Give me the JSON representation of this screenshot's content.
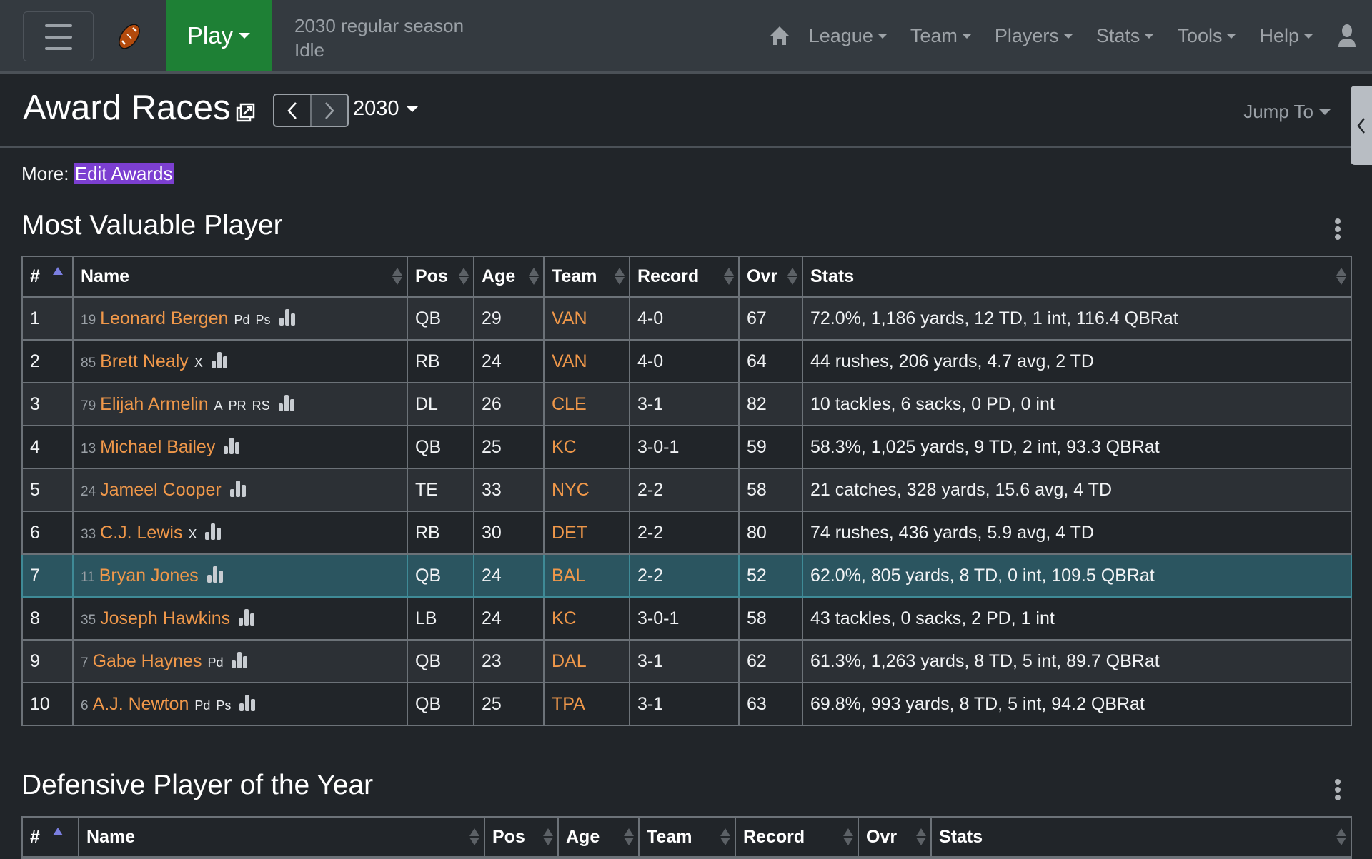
{
  "navbar": {
    "play_label": "Play",
    "status_line1": "2030 regular season",
    "status_line2": "Idle",
    "menu": [
      "League",
      "Team",
      "Players",
      "Stats",
      "Tools",
      "Help"
    ]
  },
  "header": {
    "title": "Award Races",
    "prev_label": "<",
    "next_label": ">",
    "season": "2030",
    "jump_to": "Jump To"
  },
  "more": {
    "label": "More:",
    "link": "Edit Awards"
  },
  "colors": {
    "accent_link": "#f0984a",
    "play_button": "#1e8035",
    "highlight_link_bg": "#7c3fd1",
    "highlight_row": "#2b5560"
  },
  "mvp": {
    "title": "Most Valuable Player",
    "columns": [
      "#",
      "Name",
      "Pos",
      "Age",
      "Team",
      "Record",
      "Ovr",
      "Stats"
    ],
    "rows": [
      {
        "rank": "1",
        "jersey": "19",
        "name": "Leonard Bergen",
        "skills": [
          "Pd",
          "Ps"
        ],
        "pos": "QB",
        "age": "29",
        "team": "VAN",
        "record": "4-0",
        "ovr": "67",
        "stats": "72.0%, 1,186 yards, 12 TD, 1 int, 116.4 QBRat"
      },
      {
        "rank": "2",
        "jersey": "85",
        "name": "Brett Nealy",
        "skills": [
          "X"
        ],
        "pos": "RB",
        "age": "24",
        "team": "VAN",
        "record": "4-0",
        "ovr": "64",
        "stats": "44 rushes, 206 yards, 4.7 avg, 2 TD"
      },
      {
        "rank": "3",
        "jersey": "79",
        "name": "Elijah Armelin",
        "skills": [
          "A",
          "PR",
          "RS"
        ],
        "pos": "DL",
        "age": "26",
        "team": "CLE",
        "record": "3-1",
        "ovr": "82",
        "stats": "10 tackles, 6 sacks, 0 PD, 0 int"
      },
      {
        "rank": "4",
        "jersey": "13",
        "name": "Michael Bailey",
        "skills": [],
        "pos": "QB",
        "age": "25",
        "team": "KC",
        "record": "3-0-1",
        "ovr": "59",
        "stats": "58.3%, 1,025 yards, 9 TD, 2 int, 93.3 QBRat"
      },
      {
        "rank": "5",
        "jersey": "24",
        "name": "Jameel Cooper",
        "skills": [],
        "pos": "TE",
        "age": "33",
        "team": "NYC",
        "record": "2-2",
        "ovr": "58",
        "stats": "21 catches, 328 yards, 15.6 avg, 4 TD"
      },
      {
        "rank": "6",
        "jersey": "33",
        "name": "C.J. Lewis",
        "skills": [
          "X"
        ],
        "pos": "RB",
        "age": "30",
        "team": "DET",
        "record": "2-2",
        "ovr": "80",
        "stats": "74 rushes, 436 yards, 5.9 avg, 4 TD"
      },
      {
        "rank": "7",
        "jersey": "11",
        "name": "Bryan Jones",
        "skills": [],
        "pos": "QB",
        "age": "24",
        "team": "BAL",
        "record": "2-2",
        "ovr": "52",
        "stats": "62.0%, 805 yards, 8 TD, 0 int, 109.5 QBRat",
        "highlighted": true
      },
      {
        "rank": "8",
        "jersey": "35",
        "name": "Joseph Hawkins",
        "skills": [],
        "pos": "LB",
        "age": "24",
        "team": "KC",
        "record": "3-0-1",
        "ovr": "58",
        "stats": "43 tackles, 0 sacks, 2 PD, 1 int"
      },
      {
        "rank": "9",
        "jersey": "7",
        "name": "Gabe Haynes",
        "skills": [
          "Pd"
        ],
        "pos": "QB",
        "age": "23",
        "team": "DAL",
        "record": "3-1",
        "ovr": "62",
        "stats": "61.3%, 1,263 yards, 8 TD, 5 int, 89.7 QBRat"
      },
      {
        "rank": "10",
        "jersey": "6",
        "name": "A.J. Newton",
        "skills": [
          "Pd",
          "Ps"
        ],
        "pos": "QB",
        "age": "25",
        "team": "TPA",
        "record": "3-1",
        "ovr": "63",
        "stats": "69.8%, 993 yards, 8 TD, 5 int, 94.2 QBRat"
      }
    ]
  },
  "dpoy": {
    "title": "Defensive Player of the Year",
    "columns": [
      "#",
      "Name",
      "Pos",
      "Age",
      "Team",
      "Record",
      "Ovr",
      "Stats"
    ]
  },
  "icons": {
    "menu": "hamburger-icon",
    "logo": "football-icon",
    "home": "home-icon",
    "user": "user-icon",
    "popout": "popout-icon",
    "player_stats": "bar-chart-icon",
    "options": "kebab-icon",
    "sidebar_toggle": "chevron-left-icon"
  }
}
